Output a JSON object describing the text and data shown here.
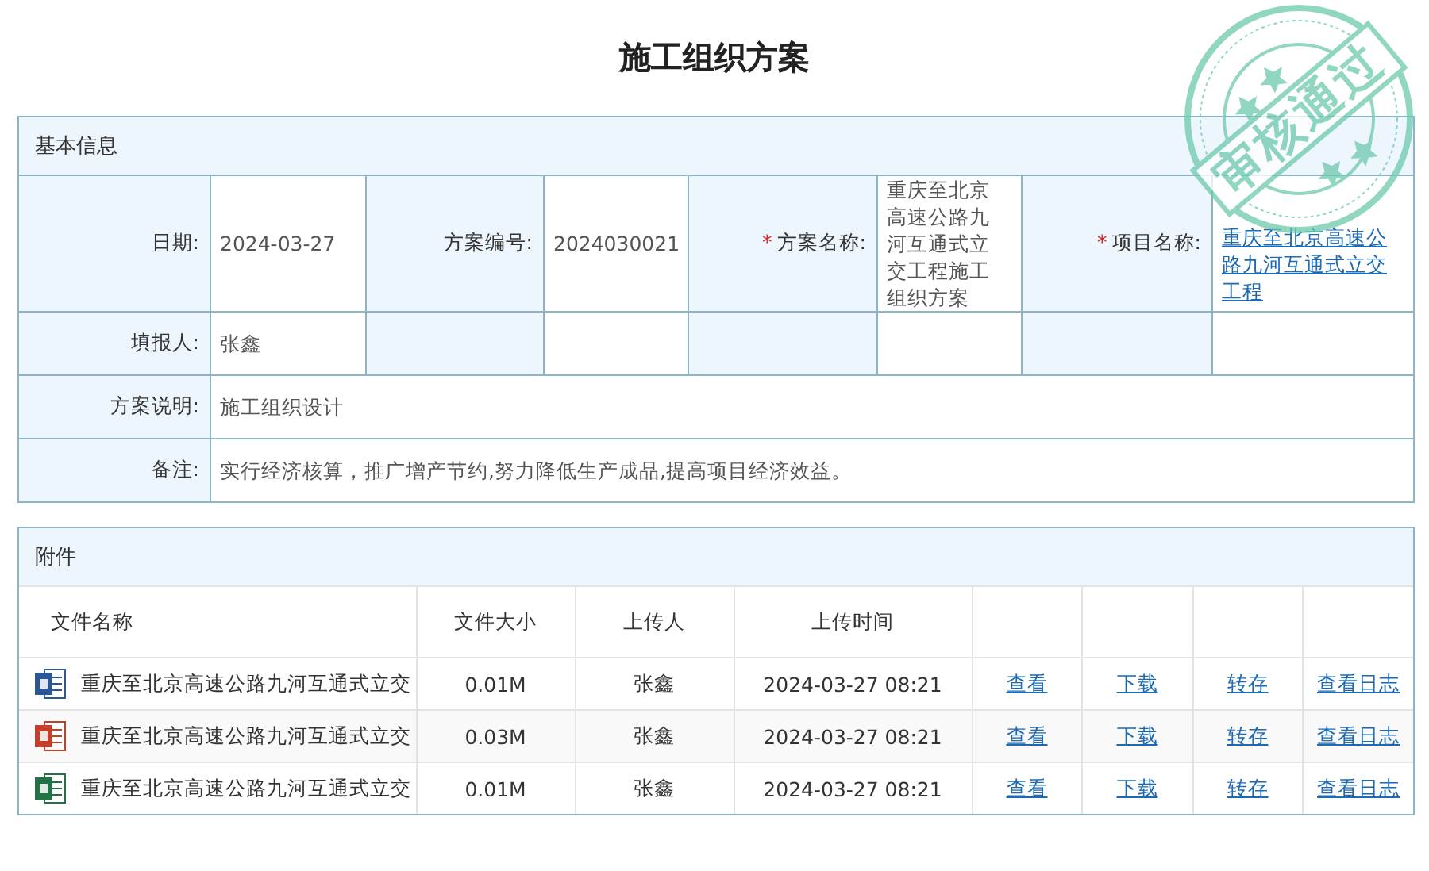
{
  "title": "施工组织方案",
  "stamp": {
    "text": "审核通过"
  },
  "basic_info": {
    "heading": "基本信息",
    "rows": [
      {
        "fields": [
          {
            "label": "日期:",
            "value": "2024-03-27",
            "kind": "text"
          },
          {
            "label": "方案编号:",
            "value": "2024030021",
            "kind": "text"
          },
          {
            "required_mark": "*",
            "label": "方案名称:",
            "value": "重庆至北京高速公路九河互通式立交工程施工组织方案",
            "kind": "text"
          },
          {
            "required_mark": "*",
            "label": "项目名称:",
            "value": "重庆至北京高速公路九河互通式立交工程",
            "kind": "link"
          }
        ]
      },
      {
        "fields": [
          {
            "label": "填报人:",
            "value": "张鑫",
            "kind": "text"
          }
        ]
      },
      {
        "fields": [
          {
            "label": "方案说明:",
            "value": "施工组织设计",
            "kind": "wide"
          }
        ]
      },
      {
        "fields": [
          {
            "label": "备注:",
            "value": "实行经济核算，推广增产节约,努力降低生产成品,提高项目经济效益。",
            "kind": "wide"
          }
        ]
      }
    ]
  },
  "attachments": {
    "heading": "附件",
    "columns": [
      "文件名称",
      "文件大小",
      "上传人",
      "上传时间"
    ],
    "rows": [
      {
        "kind": "word",
        "name": "重庆至北京高速公路九河互通式立交",
        "size": "0.01M",
        "uploader": "张鑫",
        "time": "2024-03-27 08:21",
        "actions": [
          "查看",
          "下载",
          "转存",
          "查看日志"
        ]
      },
      {
        "kind": "ppt",
        "name": "重庆至北京高速公路九河互通式立交",
        "size": "0.03M",
        "uploader": "张鑫",
        "time": "2024-03-27 08:21",
        "actions": [
          "查看",
          "下载",
          "转存",
          "查看日志"
        ]
      },
      {
        "kind": "excel",
        "name": "重庆至北京高速公路九河互通式立交",
        "size": "0.01M",
        "uploader": "张鑫",
        "time": "2024-03-27 08:21",
        "actions": [
          "查看",
          "下载",
          "转存",
          "查看日志"
        ]
      }
    ]
  }
}
